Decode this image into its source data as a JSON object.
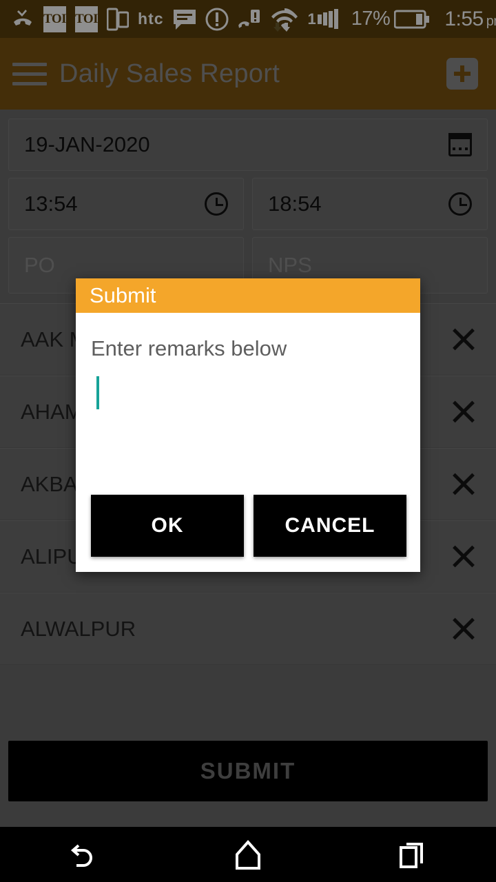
{
  "statusbar": {
    "icons": [
      "missed-call-icon",
      "toi-icon",
      "toi-icon",
      "cast-screen-icon",
      "htc-logo",
      "message-icon",
      "alert-circle-icon",
      "sim-alert-icon",
      "wifi-icon",
      "signal-icon"
    ],
    "htc_label": "htc",
    "toi_label": "TOI",
    "signal_label": "1",
    "battery_percent": "17%",
    "time": "1:55",
    "time_period": "pm"
  },
  "appbar": {
    "menu_icon": "hamburger-icon",
    "title": "Daily Sales Report",
    "add_icon": "plus-icon"
  },
  "form": {
    "date": {
      "value": "19-JAN-2020",
      "icon": "calendar-icon"
    },
    "time_from": {
      "value": "13:54",
      "icon": "clock-icon"
    },
    "time_to": {
      "value": "18:54",
      "icon": "clock-icon"
    },
    "po": {
      "placeholder": "PO"
    },
    "nps": {
      "placeholder": "NPS"
    }
  },
  "list": {
    "rows": [
      {
        "name": "AAK M",
        "remove_icon": "close-icon"
      },
      {
        "name": "AHAM",
        "remove_icon": "close-icon"
      },
      {
        "name": "AKBAR",
        "remove_icon": "close-icon"
      },
      {
        "name": "ALIPU",
        "remove_icon": "close-icon"
      },
      {
        "name": "ALWALPUR",
        "remove_icon": "close-icon"
      }
    ]
  },
  "submit_bar": {
    "label": "SUBMIT"
  },
  "dialog": {
    "title": "Submit",
    "message": "Enter remarks below",
    "input_value": "",
    "ok_label": "OK",
    "cancel_label": "CANCEL",
    "header_color": "#f4a62a",
    "caret_color": "#17a398"
  },
  "navbar": {
    "back_icon": "back-icon",
    "home_icon": "home-icon",
    "recents_icon": "recents-icon"
  }
}
